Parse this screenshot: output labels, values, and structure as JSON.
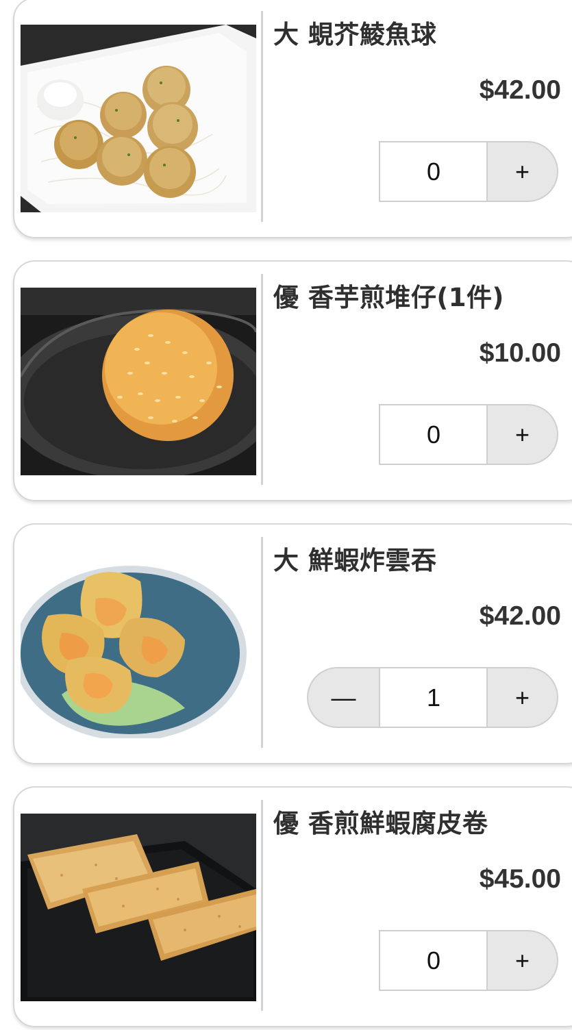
{
  "items": [
    {
      "name": "大 蜆芥鯪魚球",
      "price": "$42.00",
      "qty": "0",
      "has_minus": false,
      "plus_label": "+",
      "minus_label": "—",
      "image": "fish-balls-photo"
    },
    {
      "name": "優 香芋煎堆仔(1件)",
      "price": "$10.00",
      "qty": "0",
      "has_minus": false,
      "plus_label": "+",
      "minus_label": "—",
      "image": "sesame-ball-photo"
    },
    {
      "name": "大 鮮蝦炸雲吞",
      "price": "$42.00",
      "qty": "1",
      "has_minus": true,
      "plus_label": "+",
      "minus_label": "—",
      "image": "fried-wonton-photo"
    },
    {
      "name": "優 香煎鮮蝦腐皮卷",
      "price": "$45.00",
      "qty": "0",
      "has_minus": false,
      "plus_label": "+",
      "minus_label": "—",
      "image": "beancurd-roll-photo"
    }
  ]
}
